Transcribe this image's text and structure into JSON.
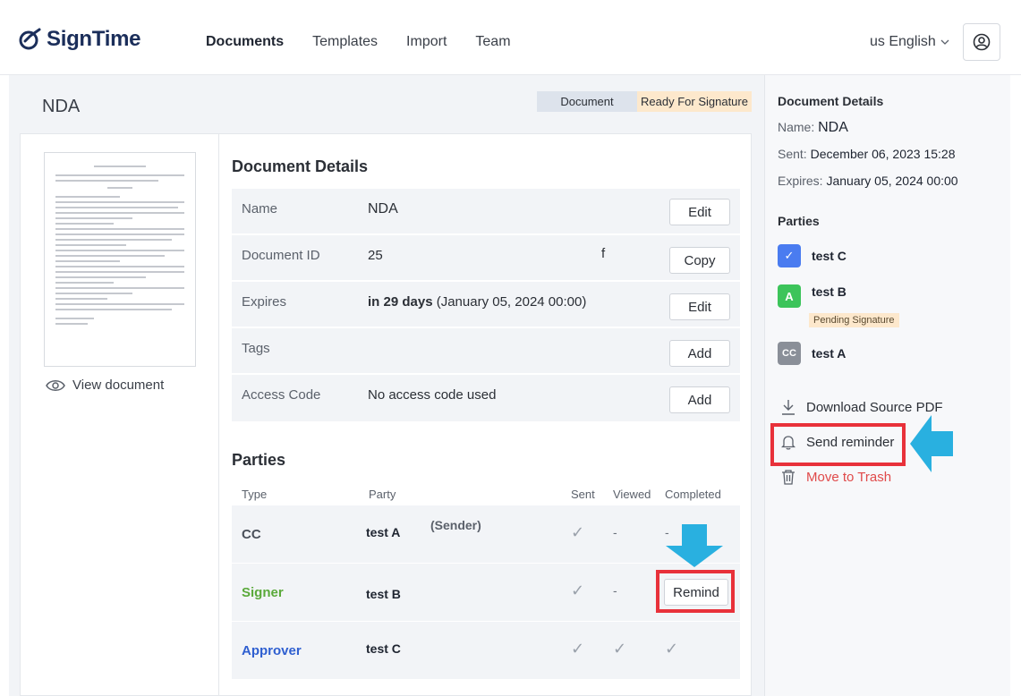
{
  "app": {
    "brand": "SignTime"
  },
  "nav": {
    "documents": "Documents",
    "templates": "Templates",
    "import": "Import",
    "team": "Team"
  },
  "lang": {
    "label": "us English"
  },
  "doc": {
    "title": "NDA",
    "badge_type": "Document",
    "badge_status": "Ready For Signature"
  },
  "preview": {
    "view_label": "View document"
  },
  "details": {
    "title": "Document Details",
    "rows": [
      {
        "label": "Name",
        "value": "NDA",
        "action": "Edit"
      },
      {
        "label": "Document ID",
        "value": "25",
        "value_extra": "f",
        "action": "Copy"
      },
      {
        "label": "Expires",
        "value_bold": "in 29 days",
        "value": "(January 05, 2024 00:00)",
        "action": "Edit"
      },
      {
        "label": "Tags",
        "value": "",
        "action": "Add"
      },
      {
        "label": "Access Code",
        "value": "No access code used",
        "action": "Add"
      }
    ]
  },
  "parties": {
    "title": "Parties",
    "headers": {
      "type": "Type",
      "party": "Party",
      "sent": "Sent",
      "viewed": "Viewed",
      "completed": "Completed"
    },
    "rows": [
      {
        "type": "CC",
        "name": "test A",
        "sender": "(Sender)",
        "viewed": "-",
        "completed": "-"
      },
      {
        "type": "Signer",
        "name": "test B",
        "viewed": "-",
        "action": "Remind"
      },
      {
        "type": "Approver",
        "name": "test C"
      }
    ]
  },
  "side": {
    "title": "Document Details",
    "name_label": "Name:",
    "name_value": "NDA",
    "sent_label": "Sent:",
    "sent_value": "December 06, 2023 15:28",
    "expires_label": "Expires:",
    "expires_value": "January 05, 2024 00:00",
    "parties_title": "Parties",
    "parties": [
      {
        "avatar": "✓",
        "name": "test C"
      },
      {
        "avatar": "A",
        "name": "test B",
        "status": "Pending Signature"
      },
      {
        "avatar": "CC",
        "name": "test A"
      }
    ],
    "actions": {
      "download": "Download Source PDF",
      "reminder": "Send reminder",
      "trash": "Move to Trash"
    }
  },
  "colors": {
    "signer": "#5aa93a",
    "approver": "#2f5fd0",
    "highlight": "#e8313a",
    "arrow": "#29b0e0"
  }
}
